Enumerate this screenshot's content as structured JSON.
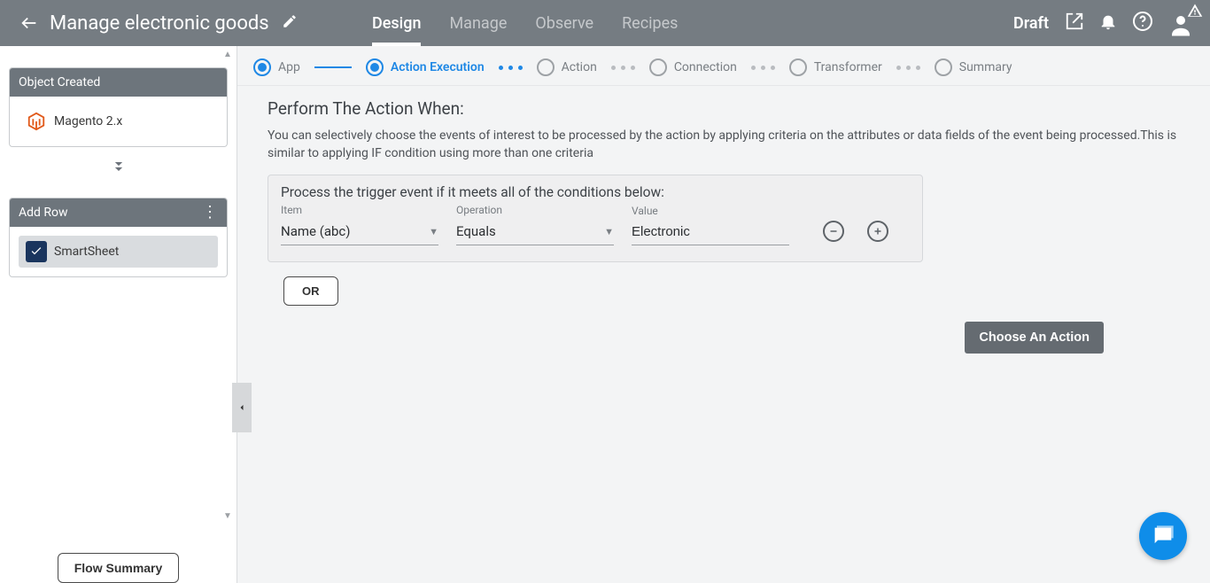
{
  "header": {
    "title": "Manage electronic goods",
    "tabs": [
      "Design",
      "Manage",
      "Observe",
      "Recipes"
    ],
    "activeTab": 0,
    "status": "Draft"
  },
  "sidebar": {
    "blocks": [
      {
        "head": "Object Created",
        "app": "Magento 2.x",
        "selected": false,
        "appColor": "#e15a1b",
        "iconBg": "transparent"
      },
      {
        "head": "Add Row",
        "app": "SmartSheet",
        "selected": true,
        "appColor": "#ffffff",
        "iconBg": "#1a355e"
      }
    ],
    "flowSummary": "Flow Summary"
  },
  "steps": [
    {
      "label": "App",
      "state": "done"
    },
    {
      "label": "Action Execution",
      "state": "current"
    },
    {
      "label": "Action",
      "state": "pending"
    },
    {
      "label": "Connection",
      "state": "pending"
    },
    {
      "label": "Transformer",
      "state": "pending"
    },
    {
      "label": "Summary",
      "state": "pending"
    }
  ],
  "main": {
    "sectionTitle": "Perform The Action When:",
    "sectionDesc": "You can selectively choose the events of interest to be processed by the action by applying criteria on the attributes or data fields of the event being processed.This is similar to applying IF condition using more than one criteria",
    "conditionsHead": "Process the trigger event if it meets all of the conditions below:",
    "labels": {
      "item": "Item",
      "operation": "Operation",
      "value": "Value"
    },
    "row": {
      "item": "Name (abc)",
      "operation": "Equals",
      "value": "Electronic"
    },
    "orLabel": "OR",
    "chooseAction": "Choose An Action"
  }
}
